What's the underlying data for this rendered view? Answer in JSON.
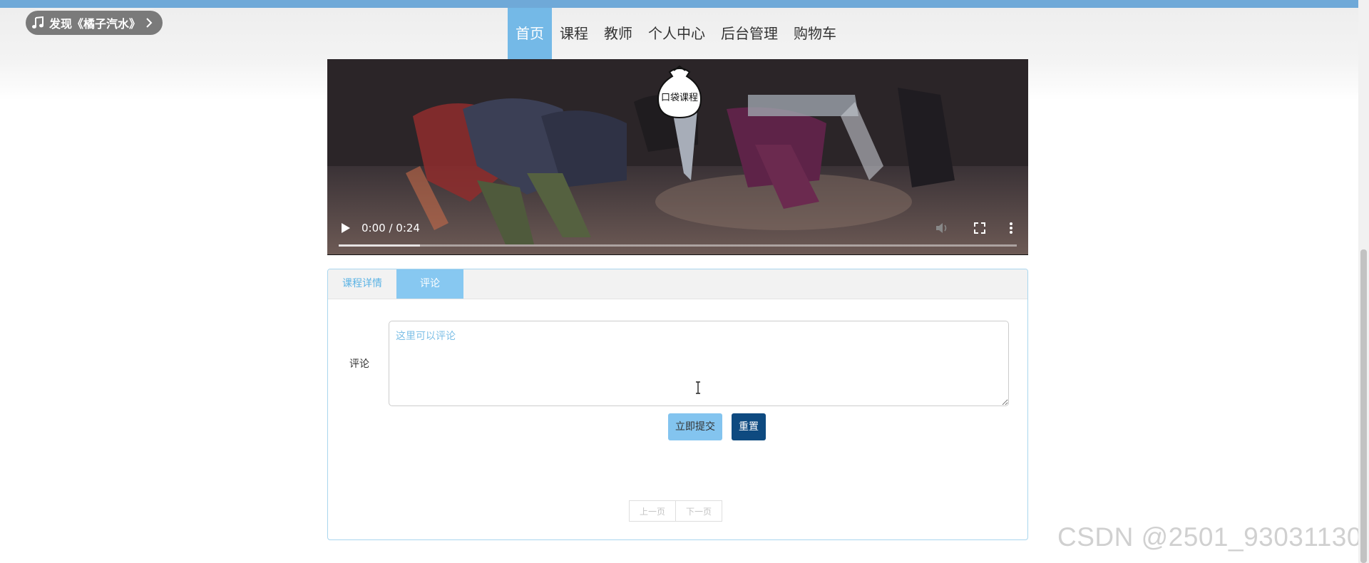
{
  "music_widget": {
    "label": "发现《橘子汽水》",
    "icon": "music-note-icon",
    "chevron": "chevron-right-icon"
  },
  "nav": {
    "items": [
      {
        "label": "首页",
        "active": true
      },
      {
        "label": "课程",
        "active": false
      },
      {
        "label": "教师",
        "active": false
      },
      {
        "label": "个人中心",
        "active": false
      },
      {
        "label": "后台管理",
        "active": false
      },
      {
        "label": "购物车",
        "active": false
      }
    ]
  },
  "video": {
    "logo_text": "口袋课程",
    "time": "0:00 / 0:24",
    "buffered_fraction": 0.12,
    "icons": [
      "play-icon",
      "volume-icon",
      "fullscreen-icon",
      "more-options-icon"
    ]
  },
  "tabs": {
    "details": "课程详情",
    "comment": "评论",
    "active": "comment"
  },
  "comment_form": {
    "label": "评论",
    "placeholder": "这里可以评论",
    "value": "",
    "submit": "立即提交",
    "reset": "重置"
  },
  "pager": {
    "prev": "上一页",
    "next": "下一页"
  },
  "watermark": "CSDN @2501_93031130",
  "colors": {
    "accent": "#74b9e7",
    "tab_active": "#87c8f1",
    "submit_bg": "#83c4ef",
    "reset_bg": "#0e4a80",
    "panel_border": "#a9d6ee",
    "top_strip": "#6fa9d8"
  }
}
